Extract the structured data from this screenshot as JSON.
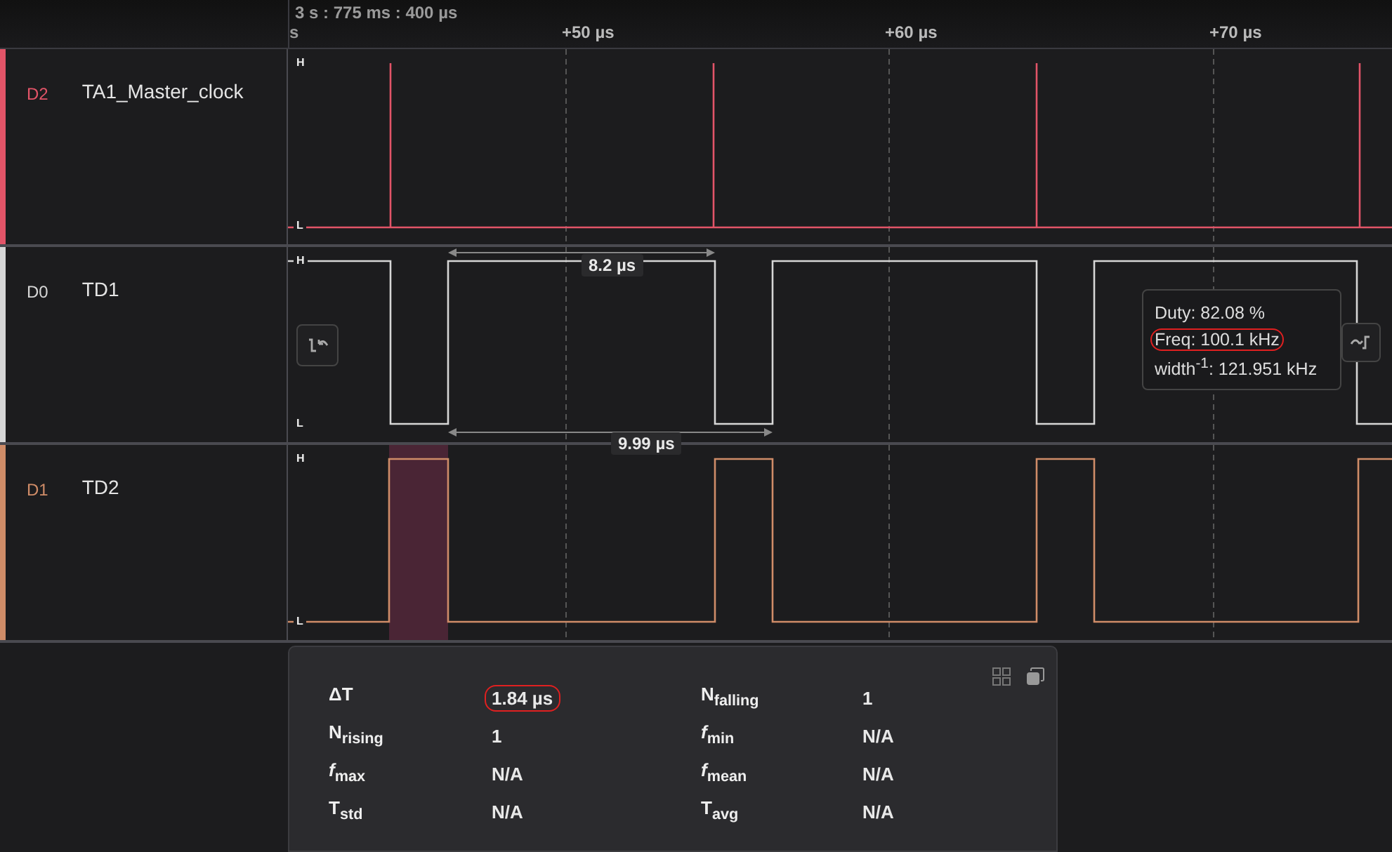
{
  "timeline": {
    "origin": "3 s : 775 ms : 400 µs",
    "cut_label": "s",
    "ticks": [
      "+50 µs",
      "+60 µs",
      "+70 µs"
    ]
  },
  "channels": [
    {
      "id": "D2",
      "name": "TA1_Master_clock",
      "color": "#e25468",
      "kind": "clock",
      "high": "H",
      "low": "L"
    },
    {
      "id": "D0",
      "name": "TD1",
      "color": "#d6d6d6",
      "kind": "td1",
      "high": "H",
      "low": "L"
    },
    {
      "id": "D1",
      "name": "TD2",
      "color": "#cf8c68",
      "kind": "td2",
      "high": "H",
      "low": "L"
    }
  ],
  "measurements": [
    {
      "label": "8.2 µs",
      "kind": "upper"
    },
    {
      "label": "9.99 µs",
      "kind": "lower"
    }
  ],
  "tooltip": {
    "lines": [
      {
        "text": "Duty: 82.08 %",
        "circled": false
      },
      {
        "text": "Freq: 100.1 kHz",
        "circled": true
      },
      {
        "text": "width$^{-1}$: 121.951 kHz",
        "circled": false
      }
    ]
  },
  "stats": [
    {
      "label": "ΔT",
      "value": "1.84 µs",
      "circled": true
    },
    {
      "label": "N$_{falling}$",
      "value": "1",
      "circled": false
    },
    {
      "label": "N$_{rising}$",
      "value": "1",
      "circled": false
    },
    {
      "label": "*f*$_{min}$",
      "value": "N/A",
      "circled": false
    },
    {
      "label": "*f*$_{max}$",
      "value": "N/A",
      "circled": false
    },
    {
      "label": "*f*$_{mean}$",
      "value": "N/A",
      "circled": false
    },
    {
      "label": "T$_{std}$",
      "value": "N/A",
      "circled": false
    },
    {
      "label": "T$_{avg}$",
      "value": "N/A",
      "circled": false
    }
  ]
}
